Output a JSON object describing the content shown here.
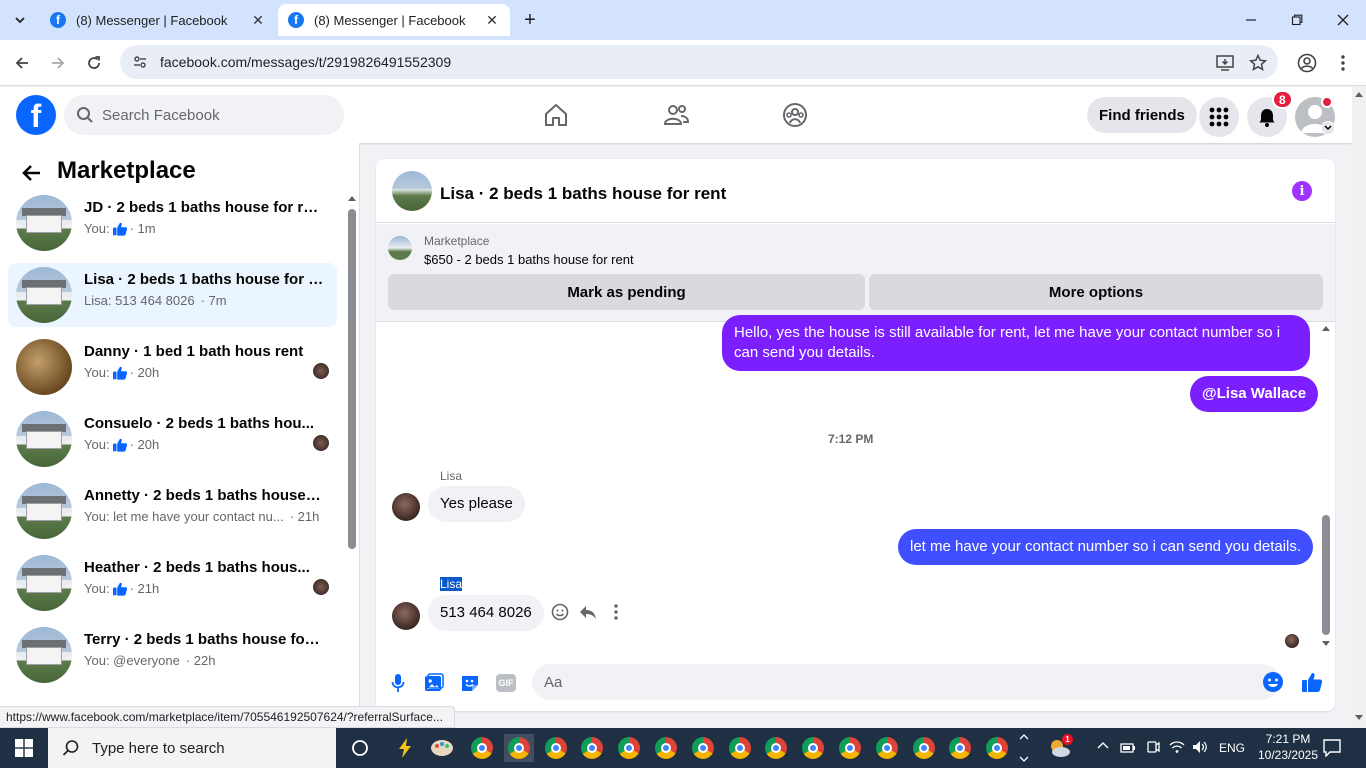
{
  "browser": {
    "tabs": [
      {
        "title": "(8) Messenger | Facebook",
        "close": "✕"
      },
      {
        "title": "(8) Messenger | Facebook",
        "close": "✕"
      }
    ],
    "new_tab": "+",
    "url": "facebook.com/messages/t/2919826491552309",
    "status_url": "https://www.facebook.com/marketplace/item/705546192507624/?referralSurface..."
  },
  "fb": {
    "logo": "f",
    "search_placeholder": "Search Facebook",
    "find_friends": "Find friends",
    "notification_count": "8"
  },
  "sidebar": {
    "title": "Marketplace",
    "conversations": [
      {
        "title": "JD · 2 beds 1 baths house for rent",
        "sub_prefix": "You:",
        "sub_text": "",
        "like": true,
        "time": "· 1m",
        "seen": false
      },
      {
        "title": "Lisa · 2 beds 1 baths house for re...",
        "sub_prefix": "Lisa: 513 464 8026",
        "sub_text": "",
        "like": false,
        "time": "· 7m",
        "seen": false,
        "active": true
      },
      {
        "title": "Danny · 1 bed 1 bath hous rent",
        "sub_prefix": "You:",
        "sub_text": "",
        "like": true,
        "time": "· 20h",
        "seen": true
      },
      {
        "title": "Consuelo · 2 beds 1 baths hou...",
        "sub_prefix": "You:",
        "sub_text": "",
        "like": true,
        "time": "· 20h",
        "seen": true
      },
      {
        "title": "Annetty · 2 beds 1 baths house f...",
        "sub_prefix": "You: let me have your contact nu...",
        "sub_text": "",
        "like": false,
        "time": "· 21h",
        "seen": false
      },
      {
        "title": "Heather · 2 beds 1 baths hous...",
        "sub_prefix": "You:",
        "sub_text": "",
        "like": true,
        "time": "· 21h",
        "seen": true
      },
      {
        "title": "Terry · 2 beds 1 baths house for ...",
        "sub_prefix": "You: @everyone",
        "sub_text": "",
        "like": false,
        "time": "· 22h",
        "seen": false
      }
    ]
  },
  "chat": {
    "title": "Lisa · 2 beds 1 baths house for rent",
    "info_icon": "i",
    "marketplace_label": "Marketplace",
    "item": "$650 - 2 beds 1 baths house for rent",
    "mark_pending": "Mark as pending",
    "more_options": "More options",
    "messages": {
      "m1": "Hello, yes the house is still available for rent, let me have your contact number so i can send you details.",
      "m2": "@Lisa Wallace",
      "time": "7:12 PM",
      "sender1": "Lisa",
      "m3": "Yes please",
      "m4": "let me have your contact number so i can send you details.",
      "sender2": "Lisa",
      "m5": "513 464 8026"
    },
    "composer_placeholder": "Aa",
    "gif_label": "GIF"
  },
  "taskbar": {
    "search_placeholder": "Type here to search",
    "language": "ENG",
    "time": "7:21 PM",
    "date": "10/23/2025",
    "weather_badge": "1"
  }
}
